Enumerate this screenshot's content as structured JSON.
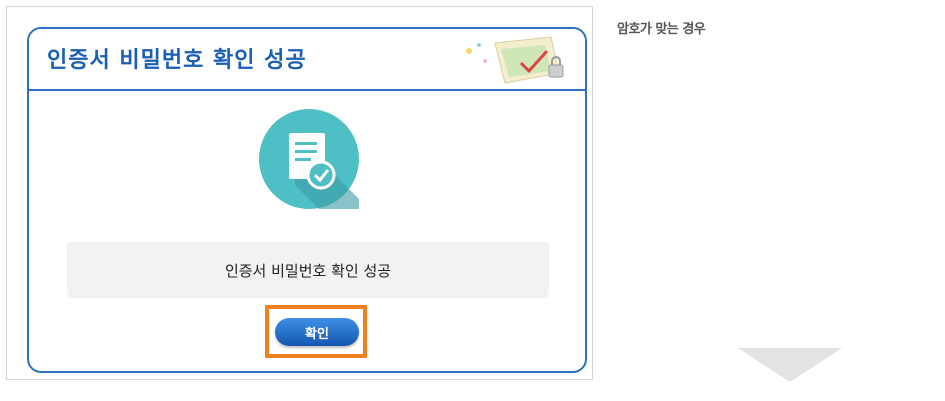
{
  "dialog": {
    "title": "인증서 비밀번호 확인 성공",
    "message": "인증서 비밀번호 확인 성공",
    "confirm_label": "확인"
  },
  "side_caption": "암호가 맞는 경우",
  "icons": {
    "header_decoration": "document-lock-icon",
    "main": "document-check-icon",
    "arrow": "down-arrow-icon"
  },
  "colors": {
    "accent": "#2b6fbf",
    "title": "#1a5fb4",
    "highlight": "#f0811d",
    "icon_circle": "#4fbfc6",
    "button": "#1456b0"
  }
}
